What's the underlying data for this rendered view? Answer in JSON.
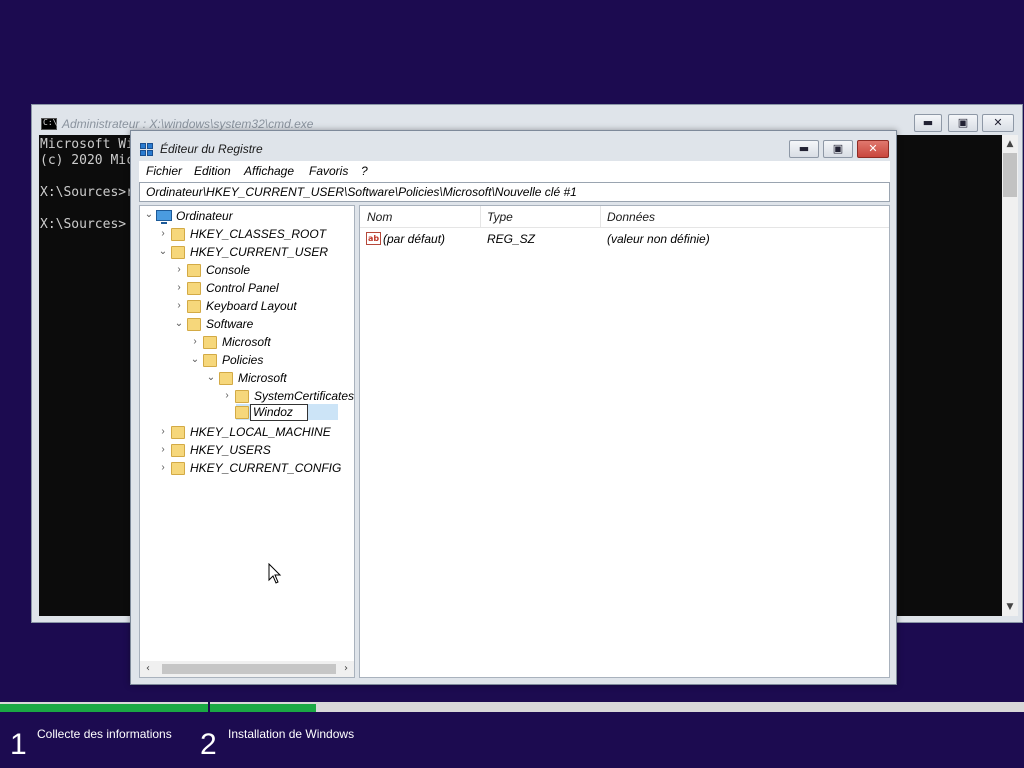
{
  "cmd": {
    "title": "Administrateur : X:\\windows\\system32\\cmd.exe",
    "lines": [
      "Microsoft Wi",
      "(c) 2020 Mic",
      "",
      "X:\\Sources>r",
      "",
      "X:\\Sources>"
    ],
    "buttons": {
      "minimize": "▬",
      "maximize": "▣",
      "close": "✕"
    }
  },
  "regedit": {
    "title": "Éditeur du Registre",
    "menu": [
      "Fichier",
      "Edition",
      "Affichage",
      "Favoris",
      "?"
    ],
    "address": "Ordinateur\\HKEY_CURRENT_USER\\Software\\Policies\\Microsoft\\Nouvelle clé #1",
    "tree": {
      "computer": "Ordinateur",
      "hkcr": "HKEY_CLASSES_ROOT",
      "hkcu": "HKEY_CURRENT_USER",
      "console": "Console",
      "control_panel": "Control Panel",
      "keyboard_layout": "Keyboard Layout",
      "software": "Software",
      "sw_microsoft": "Microsoft",
      "policies": "Policies",
      "pol_microsoft": "Microsoft",
      "system_certificates": "SystemCertificates",
      "editing_value": "Windoz",
      "hklm": "HKEY_LOCAL_MACHINE",
      "hku": "HKEY_USERS",
      "hkcc": "HKEY_CURRENT_CONFIG"
    },
    "columns": {
      "name": "Nom",
      "type": "Type",
      "data": "Données"
    },
    "values": [
      {
        "icon": "ab",
        "name": "(par défaut)",
        "type": "REG_SZ",
        "data": "(valeur non définie)"
      }
    ],
    "buttons": {
      "minimize": "▬",
      "maximize": "▣",
      "close": "✕"
    }
  },
  "setup": {
    "steps": [
      {
        "number": "1",
        "label": "Collecte des informations",
        "progress": 1.0
      },
      {
        "number": "2",
        "label": "Installation de Windows",
        "progress": 0.13
      }
    ]
  },
  "colors": {
    "background": "#1c0b50",
    "progress": "#1aa844",
    "close_button": "#c9463d"
  }
}
